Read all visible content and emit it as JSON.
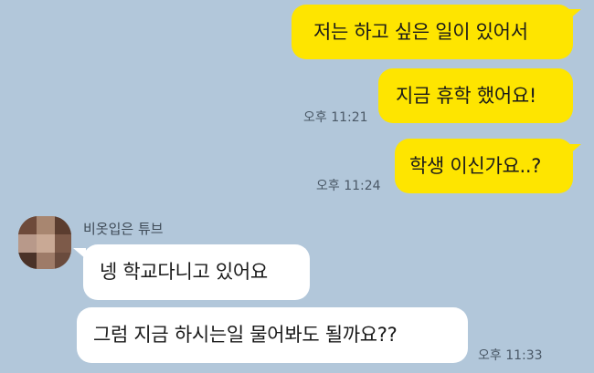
{
  "messages": {
    "sent": [
      {
        "text": "저는 하고 싶은 일이 있어서"
      },
      {
        "text": "지금 휴학 했어요!",
        "time": "오후 11:21"
      },
      {
        "text": "학생 이신가요..?",
        "time": "오후 11:24"
      }
    ],
    "received": {
      "sender": "비옷입은 튜브",
      "items": [
        {
          "text": "넹 학교다니고 있어요"
        },
        {
          "text": "그럼 지금 하시는일 물어봐도 될까요??",
          "time": "오후 11:33"
        }
      ]
    }
  },
  "colors": {
    "background": "#b2c7da",
    "sent_bubble": "#fee500",
    "received_bubble": "#ffffff"
  }
}
